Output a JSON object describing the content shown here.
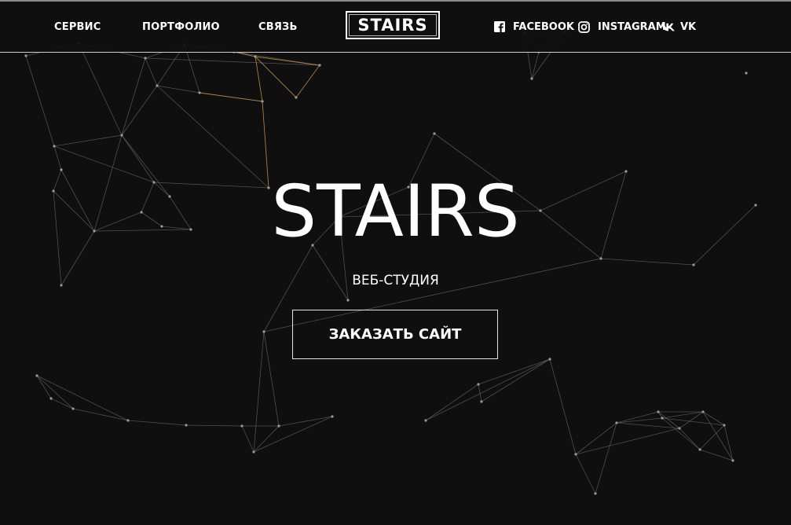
{
  "nav": {
    "items": [
      {
        "label": "СЕРВИС"
      },
      {
        "label": "ПОРТФОЛИО"
      },
      {
        "label": "СВЯЗЬ"
      }
    ]
  },
  "logo": {
    "text": "STAIRS"
  },
  "social": {
    "facebook": {
      "label": "FACEBOOK",
      "icon": "facebook-icon"
    },
    "instagram": {
      "label": "INSTAGRAM",
      "icon": "instagram-icon"
    },
    "vk": {
      "label": "VK",
      "icon": "vk-icon"
    }
  },
  "hero": {
    "title": "STAIRS",
    "subtitle": "ВЕБ-СТУДИЯ",
    "cta_label": "ЗАКАЗАТЬ САЙТ"
  },
  "colors": {
    "background": "#0f0f0f",
    "text": "#ffffff",
    "line": "#5a5a5a",
    "accent_line": "#b8893a"
  }
}
